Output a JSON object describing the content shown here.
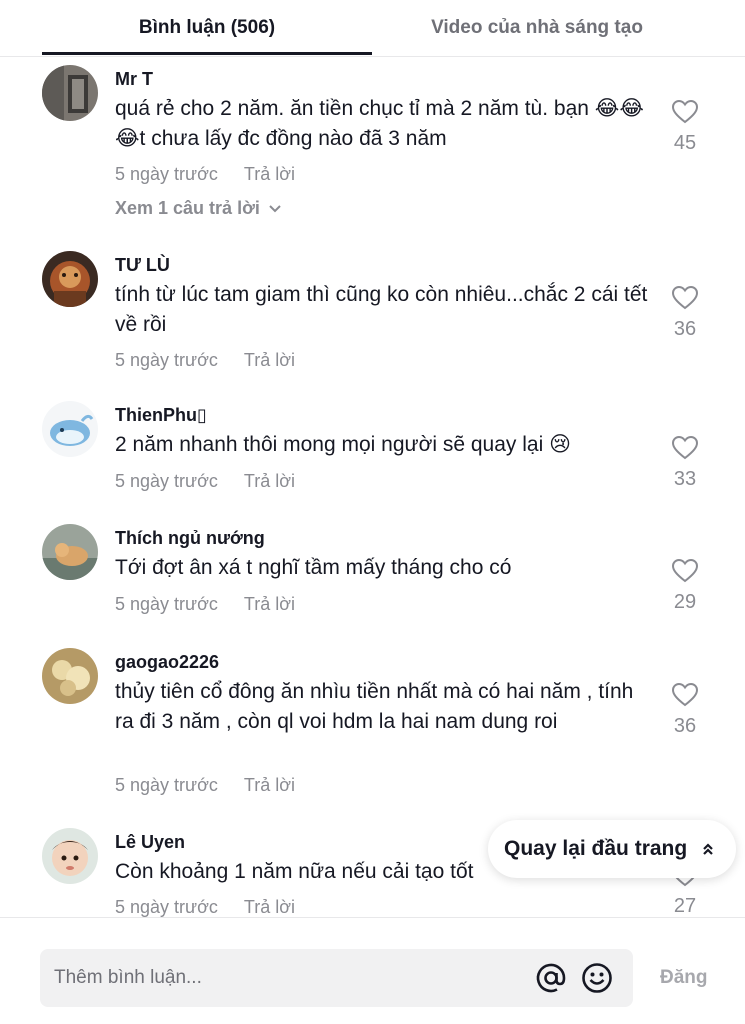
{
  "tabs": {
    "comments_label": "Bình luận (506)",
    "creator_videos_label": "Video của nhà sáng tạo"
  },
  "comments": [
    {
      "username": "Mr T",
      "text": "quá rẻ cho 2 năm. ăn tiền chục tỉ mà 2 năm tù. bạn 😂😂😂t chưa lấy đc đồng nào đã 3 năm",
      "time": "5 ngày trước",
      "reply": "Trả lời",
      "likes": "45",
      "view_replies": "Xem 1 câu trả lời"
    },
    {
      "username": "TƯ LÙ",
      "text": "tính từ lúc tam giam thì cũng ko còn nhiêu...chắc 2 cái tết về rồi",
      "time": "5 ngày trước",
      "reply": "Trả lời",
      "likes": "36"
    },
    {
      "username": "ThienPhu▯",
      "text": "2 năm nhanh thôi mong mọi người sẽ quay lại 😢",
      "time": "5 ngày trước",
      "reply": "Trả lời",
      "likes": "33"
    },
    {
      "username": "Thích ngủ nướng",
      "text": "Tới đợt ân xá t nghĩ tầm mấy tháng cho có",
      "time": "5 ngày trước",
      "reply": "Trả lời",
      "likes": "29"
    },
    {
      "username": "gaogao2226",
      "text": "thủy tiên cổ đông ăn nhìu tiền nhất mà có hai năm , tính ra đi 3 năm , còn ql voi hdm la hai nam dung roi",
      "time": "5 ngày trước",
      "reply": "Trả lời",
      "likes": "36"
    },
    {
      "username": "Lê Uyen",
      "text": "Còn khoảng 1 năm nữa nếu cải tạo tốt",
      "time": "5 ngày trước",
      "reply": "Trả lời",
      "likes": "27"
    }
  ],
  "back_to_top": {
    "label": "Quay lại đầu trang"
  },
  "composer": {
    "placeholder": "Thêm bình luận...",
    "post_label": "Đăng",
    "at_icon": "at-mention-icon",
    "emoji_icon": "emoji-icon"
  },
  "colors": {
    "text_primary": "#161823",
    "text_secondary": "#8a8b91",
    "tab_underline": "#161823",
    "input_bg": "#f1f1f2"
  }
}
